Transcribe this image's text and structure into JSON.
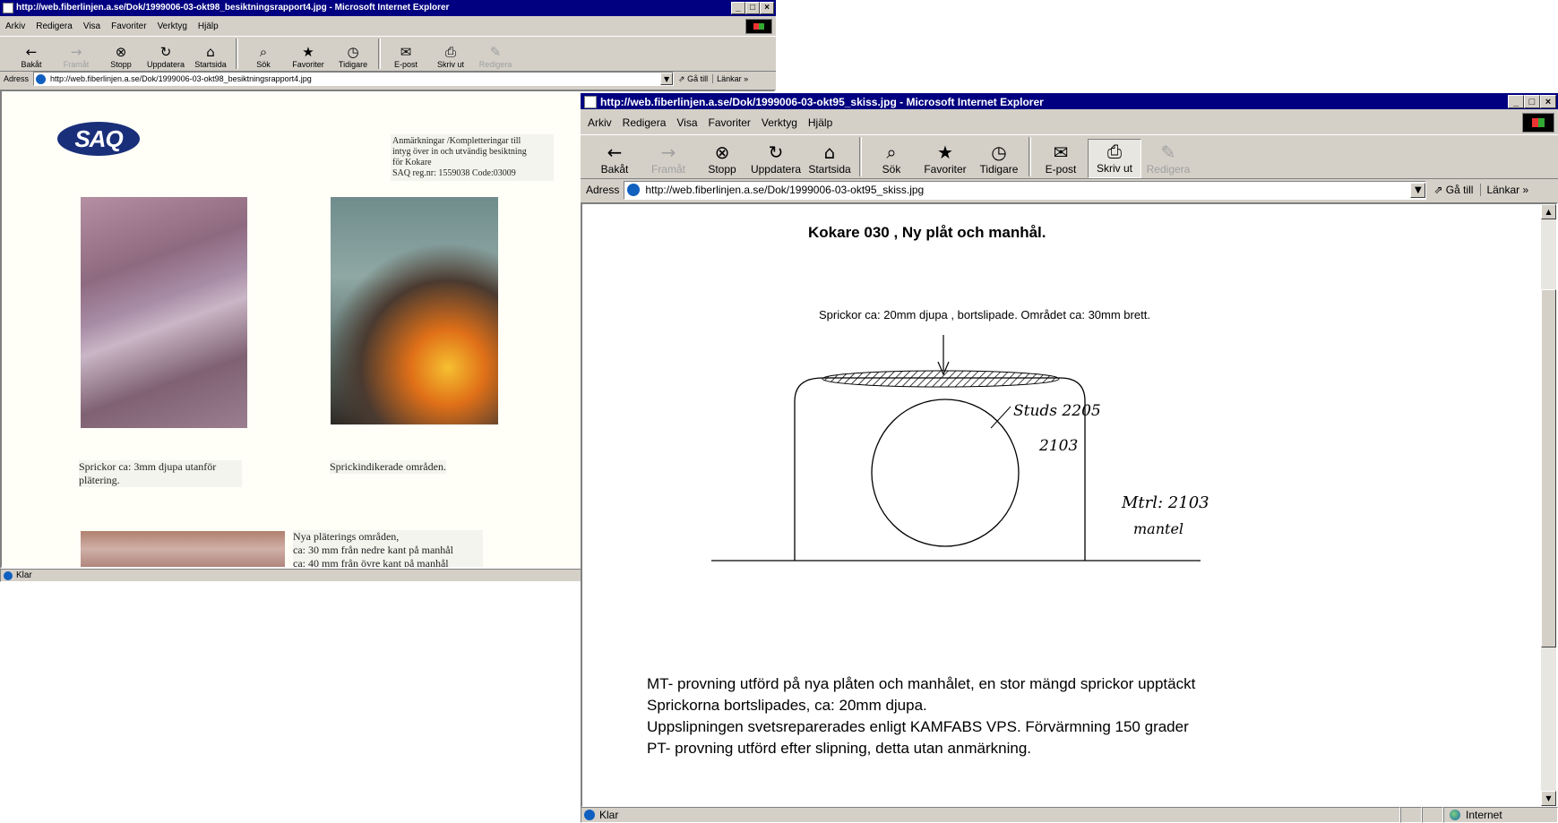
{
  "window_back": {
    "title": "http://web.fiberlinjen.a.se/Dok/1999006-03-okt98_besiktningsrapport4.jpg - Microsoft Internet Explorer",
    "menu": [
      "Arkiv",
      "Redigera",
      "Visa",
      "Favoriter",
      "Verktyg",
      "Hjälp"
    ],
    "toolbar": {
      "back": "Bakåt",
      "forward": "Framåt",
      "stop": "Stopp",
      "refresh": "Uppdatera",
      "home": "Startsida",
      "search": "Sök",
      "favorites": "Favoriter",
      "history": "Tidigare",
      "mail": "E-post",
      "print": "Skriv ut",
      "edit": "Redigera"
    },
    "address_label": "Adress",
    "address_value": "http://web.fiberlinjen.a.se/Dok/1999006-03-okt98_besiktningsrapport4.jpg",
    "go_label": "Gå till",
    "links_label": "Länkar »",
    "status": "Klar",
    "document": {
      "logo_text": "SAQ",
      "notes": [
        "Anmärkningar /Kompletteringar till",
        "intyg över in och utvändig besiktning",
        "för Kokare",
        "SAQ reg.nr: 1559038  Code:03009"
      ],
      "caption_1": "Sprickor ca: 3mm djupa utanför plätering.",
      "caption_2": "Sprickindikerade områden.",
      "caption_3": [
        "Nya pläterings områden,",
        "ca: 30 mm från nedre kant på manhål",
        "ca: 40 mm från övre kant på manhål"
      ]
    }
  },
  "window_front": {
    "title": "http://web.fiberlinjen.a.se/Dok/1999006-03-okt95_skiss.jpg - Microsoft Internet Explorer",
    "menu": [
      "Arkiv",
      "Redigera",
      "Visa",
      "Favoriter",
      "Verktyg",
      "Hjälp"
    ],
    "toolbar": {
      "back": "Bakåt",
      "forward": "Framåt",
      "stop": "Stopp",
      "refresh": "Uppdatera",
      "home": "Startsida",
      "search": "Sök",
      "favorites": "Favoriter",
      "history": "Tidigare",
      "mail": "E-post",
      "print": "Skriv ut",
      "edit": "Redigera"
    },
    "address_label": "Adress",
    "address_value": "http://web.fiberlinjen.a.se/Dok/1999006-03-okt95_skiss.jpg",
    "go_label": "Gå till",
    "links_label": "Länkar »",
    "status": "Klar",
    "zone": "Internet",
    "document": {
      "title": "Kokare 030 , Ny plåt och manhål.",
      "subtitle": "Sprickor ca: 20mm djupa , bortslipade. Området ca: 30mm brett.",
      "handwriting_1": "Studs 2205",
      "handwriting_2": "2103",
      "handwriting_3": "Mtrl: 2103",
      "handwriting_4": "mantel",
      "lines": [
        "MT- provning utförd på nya plåten och manhålet, en stor mängd sprickor upptäckt",
        "Sprickorna bortslipades, ca: 20mm djupa.",
        "Uppslipningen svetsreparerades enligt KAMFABS  VPS. Förvärmning 150 grader",
        "PT- provning utförd efter slipning, detta utan anmärkning."
      ]
    }
  },
  "icons": {
    "back": "←",
    "forward": "→",
    "stop": "⊗",
    "refresh": "↻",
    "home": "⌂",
    "search": "⌕",
    "favorites": "★",
    "history": "◷",
    "mail": "✉",
    "print": "⎙",
    "edit": "✎",
    "go": "⇗",
    "minimize": "_",
    "maximize": "□",
    "close": "×",
    "up": "▲",
    "down": "▼"
  },
  "colors": {
    "titlebar": "#000080",
    "chrome": "#d4d0c8"
  }
}
